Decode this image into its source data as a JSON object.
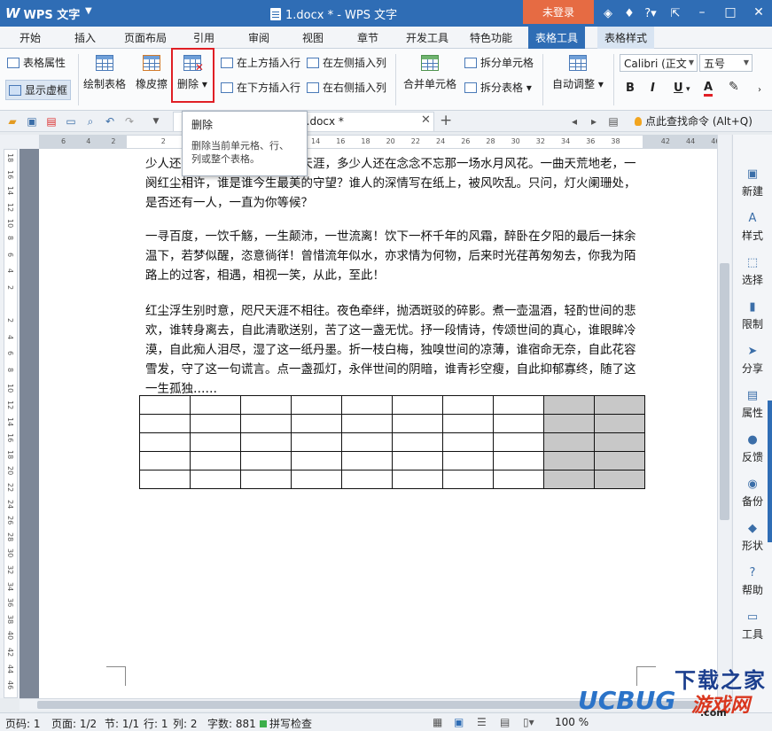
{
  "titlebar": {
    "app_name": "WPS 文字",
    "doc_title": "1.docx * - WPS 文字",
    "login_label": "未登录",
    "icons": [
      "shirt-icon",
      "help-icon",
      "window-restore-icon",
      "minimize-icon",
      "maximize-icon",
      "close-icon"
    ]
  },
  "menu": {
    "tabs": [
      "开始",
      "插入",
      "页面布局",
      "引用",
      "审阅",
      "视图",
      "章节",
      "开发工具",
      "特色功能",
      "表格工具",
      "表格样式"
    ]
  },
  "ribbon": {
    "table_props": "表格属性",
    "show_gridlines": "显示虚框",
    "draw_table": "绘制表格",
    "eraser": "橡皮擦",
    "delete": "删除",
    "insert_row_above": "在上方插入行",
    "insert_row_below": "在下方插入行",
    "insert_col_left": "在左侧插入列",
    "insert_col_right": "在右侧插入列",
    "merge_cells": "合并单元格",
    "split_cells": "拆分单元格",
    "split_table": "拆分表格",
    "auto_fit": "自动调整",
    "font_name": "Calibri (正文",
    "font_size": "五号",
    "bold": "B",
    "italic": "I",
    "underline": "U",
    "font_color": "A"
  },
  "toolbar": {
    "doc_tab": "1.docx *",
    "find_command": "点此查找命令 (Alt+Q)"
  },
  "tooltip": {
    "title": "删除",
    "desc": "删除当前单元格、行、列或整个表格。"
  },
  "ruler": {
    "h_numbers": [
      "6",
      "4",
      "2",
      "",
      "2",
      "4",
      "6",
      "8",
      "10",
      "12",
      "14",
      "16",
      "18",
      "20",
      "22",
      "24",
      "26",
      "28",
      "30",
      "32",
      "34",
      "36",
      "38",
      "",
      "42",
      "44",
      "46"
    ],
    "v_numbers": [
      "18",
      "16",
      "14",
      "12",
      "10",
      "8",
      "6",
      "4",
      "2",
      "",
      "2",
      "4",
      "6",
      "8",
      "10",
      "12",
      "14",
      "16",
      "18",
      "20",
      "22",
      "24",
      "26",
      "28",
      "30",
      "32",
      "34",
      "36",
      "38",
      "40",
      "42",
      "44",
      "46"
    ]
  },
  "document": {
    "paragraphs": [
      "少人还记得那一缕温柔？陌路天涯，多少人还在念念不忘那一场水月风花。一曲天荒地老，一阕红尘相许，谁是谁今生最美的守望？谁人的深情写在纸上，被风吹乱。只问，灯火阑珊处，是否还有一人，一直为你等候？",
      "一寻百度，一饮千觞，一生颠沛，一世流离！饮下一杯千年的风霜，醉卧在夕阳的最后一抹余温下，若梦似醒，恣意徜徉！曾惜流年似水，亦求情为何物，后来时光荏苒匆匆去，你我为陌路上的过客，相遇，相视一笑，从此，至此！",
      "红尘浮生别时意，咫尺天涯不相往。夜色牵绊，抛洒斑驳的碎影。煮一壶温酒，轻酌世间的悲欢，谁转身离去，自此清歌送别，苦了这一盏无忧。抒一段情诗，传颂世间的真心，谁眼眸冷漠，自此痴人泪尽，湿了这一纸丹墨。折一枝白梅，独嗅世间的凉薄，谁宿命无奈，自此花容雪发，守了这一句谎言。点一盏孤灯，永伴世间的阴暗，谁青衫空瘦，自此抑郁寡终，随了这一生孤独……"
    ],
    "table": {
      "rows": 5,
      "cols": 10,
      "gray_cols": [
        8,
        9
      ]
    }
  },
  "sidebar": {
    "items": [
      {
        "label": "新建",
        "icon": "new-doc-icon"
      },
      {
        "label": "样式",
        "icon": "style-icon"
      },
      {
        "label": "选择",
        "icon": "select-icon"
      },
      {
        "label": "限制",
        "icon": "restrict-icon"
      },
      {
        "label": "分享",
        "icon": "share-icon"
      },
      {
        "label": "属性",
        "icon": "properties-icon"
      },
      {
        "label": "反馈",
        "icon": "feedback-icon"
      },
      {
        "label": "备份",
        "icon": "backup-icon"
      },
      {
        "label": "形状",
        "icon": "shape-icon"
      },
      {
        "label": "帮助",
        "icon": "help-icon"
      },
      {
        "label": "工具",
        "icon": "toolbox-icon"
      }
    ]
  },
  "status": {
    "page_code": "页码: 1",
    "page": "页面: 1/2",
    "section": "节: 1/1",
    "row": "行: 1",
    "col": "列: 2",
    "words": "字数: 881",
    "spell": "拼写检查",
    "zoom": "100 %"
  },
  "watermark": {
    "line1": "下载之家",
    "line2": "UCBUG",
    "line3": "游戏网",
    "line4": ".com"
  }
}
